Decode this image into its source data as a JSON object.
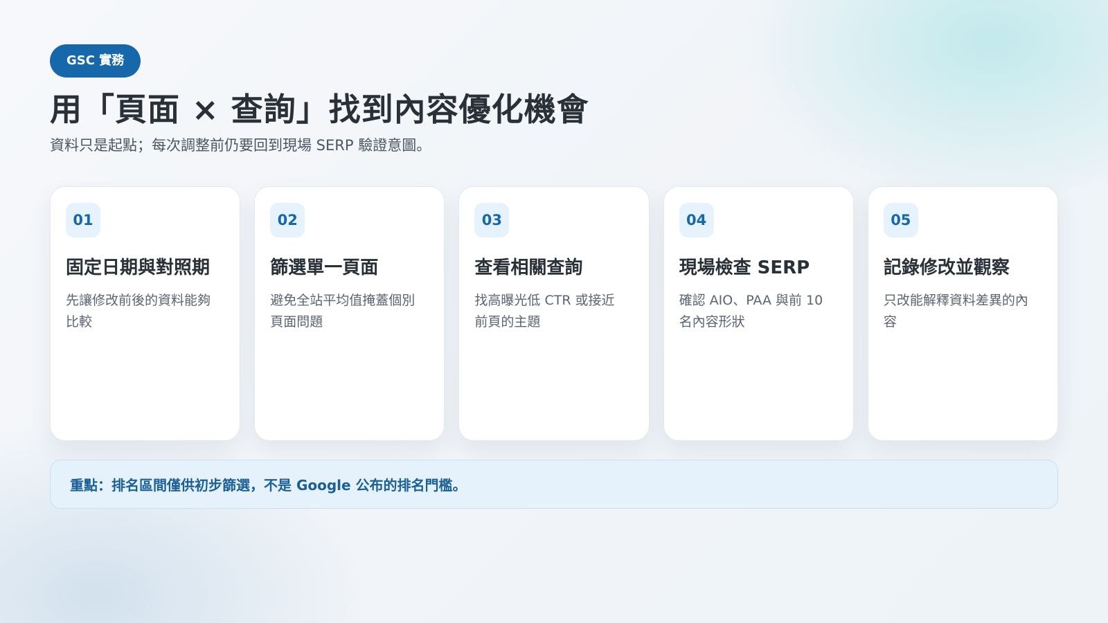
{
  "tag": "GSC 實務",
  "title": "用「頁面 × 查詢」找到內容優化機會",
  "subtitle": "資料只是起點；每次調整前仍要回到現場 SERP 驗證意圖。",
  "cards": [
    {
      "number": "01",
      "title": "固定日期與對照期",
      "desc": "先讓修改前後的資料能夠比較"
    },
    {
      "number": "02",
      "title": "篩選單一頁面",
      "desc": "避免全站平均值掩蓋個別頁面問題"
    },
    {
      "number": "03",
      "title": "查看相關查詢",
      "desc": "找高曝光低 CTR 或接近前頁的主題"
    },
    {
      "number": "04",
      "title": "現場檢查 SERP",
      "desc": "確認 AIO、PAA 與前 10 名內容形狀"
    },
    {
      "number": "05",
      "title": "記錄修改並觀察",
      "desc": "只改能解釋資料差異的內容"
    }
  ],
  "callout": "重點：排名區間僅供初步篩選，不是 Google 公布的排名門檻。",
  "colors": {
    "accent": "#1668aa",
    "badge_bg": "#e7f3fc",
    "callout_bg": "#e6f2fb",
    "callout_text": "#1a5f96"
  }
}
